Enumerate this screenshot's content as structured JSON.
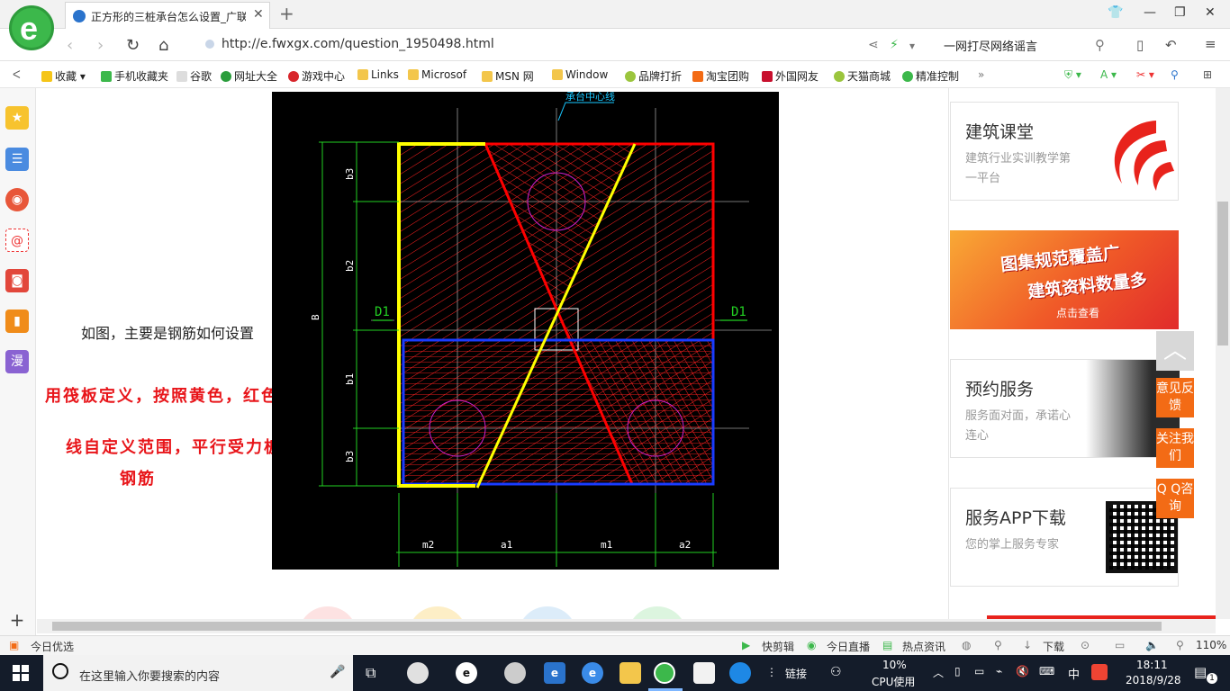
{
  "browser": {
    "tab_title": "正方形的三桩承台怎么设置_广联",
    "url": "http://e.fwxgx.com/question_1950498.html",
    "search_text": "一网打尽网络谣言",
    "logo_letter": "e"
  },
  "bookmarks": [
    "收藏",
    "手机收藏夹",
    "谷歌",
    "网址大全",
    "游戏中心",
    "Links",
    "Microsof",
    "MSN 网",
    "Window",
    "品牌打折",
    "淘宝团购",
    "外国网友",
    "天猫商城",
    "精准控制"
  ],
  "sidebar": {
    "last_label": "漫"
  },
  "content": {
    "caption": "如图，主要是钢筋如何设置",
    "annotation_lines": [
      "用筏板定义，按照黄色，红色，蓝色",
      "线自定义范围，平行受力板布置",
      "钢筋"
    ],
    "cad": {
      "top_label": "承台中心线",
      "section_left": "D1",
      "section_right": "D1",
      "vertical_dims": [
        "b3",
        "b2",
        "b1",
        "b3"
      ],
      "overall_dim": "B",
      "horizontal_dims": [
        "m2",
        "a1",
        "m1",
        "a2"
      ]
    }
  },
  "right_column": {
    "card1": {
      "title": "建筑课堂",
      "subtitle": "建筑行业实训教学第一平台"
    },
    "banner": {
      "line1": "图集规范覆盖广",
      "line2": "建筑资料数量多",
      "cta": "点击查看"
    },
    "card2": {
      "title": "预约服务",
      "subtitle": "服务面对面，承诺心连心"
    },
    "card3": {
      "title": "服务APP下载",
      "subtitle": "您的掌上服务专家"
    }
  },
  "float_buttons": {
    "feedback": "意见反馈",
    "follow": "关注我们",
    "qq": "Q Q咨询"
  },
  "statusbar": {
    "left": "今日优选",
    "items": [
      "快剪辑",
      "今日直播",
      "热点资讯",
      "下载"
    ],
    "zoom": "110%"
  },
  "taskbar": {
    "search_placeholder": "在这里输入你要搜索的内容",
    "link_label": "链接",
    "cpu_percent": "10%",
    "cpu_label": "CPU使用",
    "ime": "中",
    "time": "18:11",
    "date": "2018/9/28",
    "notify_count": "1"
  },
  "colors": {
    "brand_green": "#3cb84b",
    "cad_background": "#000000",
    "boundary_yellow": "#ffff00",
    "boundary_red": "#ff0000",
    "boundary_blue": "#1a3cff",
    "float_orange": "#f36b15",
    "annotation_red": "#e8151a"
  }
}
